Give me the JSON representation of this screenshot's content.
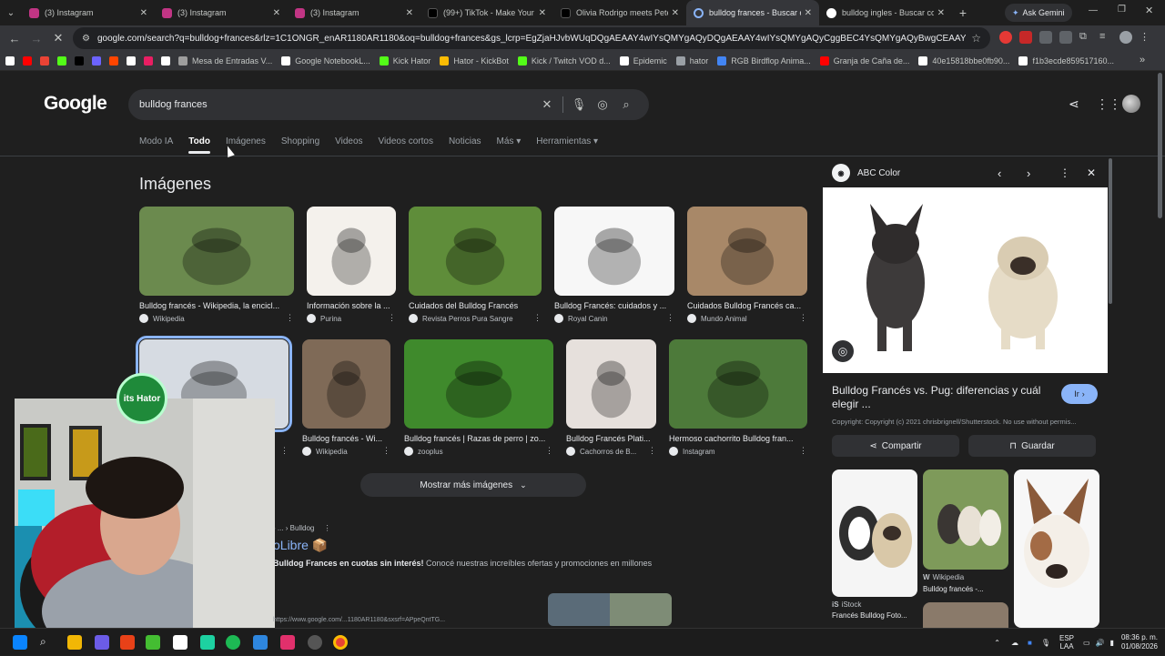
{
  "tabs": [
    {
      "label": "(3) Instagram",
      "color": "#c13584"
    },
    {
      "label": "(3) Instagram",
      "color": "#c13584"
    },
    {
      "label": "(3) Instagram",
      "color": "#c13584"
    },
    {
      "label": "(99+) TikTok - Make Your Da",
      "color": "#000000"
    },
    {
      "label": "Olivia Rodrigo meets Peter",
      "color": "#000000"
    },
    {
      "label": "bulldog frances - Buscar co",
      "color": "#4285f4",
      "active": true
    },
    {
      "label": "bulldog ingles - Buscar con",
      "color": "#4285f4"
    }
  ],
  "window": {
    "ask_gemini": "Ask Gemini"
  },
  "address": {
    "url": "google.com/search?q=bulldog+frances&rlz=1C1ONGR_enAR1180AR1180&oq=bulldog+frances&gs_lcrp=EgZjaHJvbWUqDQgAEAAY4wIYsQMYgAQyDQgAEAAY4wIYsQMYgAQyCggBEC4YsQMYgAQyBwgCEAAYgAQyCggDEAAYsQMYgAQyBwgEEAAYgAQyBwgFEAAYgAQ..."
  },
  "bookmarks": [
    {
      "label": "",
      "color": "#ffffff"
    },
    {
      "label": "",
      "color": "#ff0000"
    },
    {
      "label": "",
      "color": "#ea4335"
    },
    {
      "label": "",
      "color": "#53fc18"
    },
    {
      "label": "",
      "color": "#000000"
    },
    {
      "label": "",
      "color": "#6c63ff"
    },
    {
      "label": "",
      "color": "#ff4500"
    },
    {
      "label": "",
      "color": "#ffffff"
    },
    {
      "label": "",
      "color": "#e91e63"
    },
    {
      "label": "",
      "color": "#ffffff"
    },
    {
      "label": "Mesa de Entradas V...",
      "color": "#9e9e9e"
    },
    {
      "label": "Google NotebookL...",
      "color": "#ffffff"
    },
    {
      "label": "Kick Hator",
      "color": "#53fc18"
    },
    {
      "label": "Hator - KickBot",
      "color": "#fbbc04"
    },
    {
      "label": "Kick / Twitch VOD d...",
      "color": "#53fc18"
    },
    {
      "label": "Epidemic",
      "color": "#ffffff"
    },
    {
      "label": "hator",
      "color": "#9aa0a6"
    },
    {
      "label": "RGB Birdflop Anima...",
      "color": "#4285f4"
    },
    {
      "label": "Granja de Caña de...",
      "color": "#ff0000"
    },
    {
      "label": "40e15818bbe0fb90...",
      "color": "#ffffff"
    },
    {
      "label": "f1b3ecde859517160...",
      "color": "#ffffff"
    }
  ],
  "google": {
    "logo": "Google",
    "query": "bulldog frances",
    "tabs": [
      "Modo IA",
      "Todo",
      "Imágenes",
      "Shopping",
      "Videos",
      "Videos cortos",
      "Noticias",
      "Más ▾",
      "Herramientas ▾"
    ],
    "images_heading": "Imágenes",
    "show_more": "Mostrar más imágenes",
    "row1": [
      {
        "title": "Bulldog francés - Wikipedia, la encicl...",
        "source": "Wikipedia",
        "bg": "#6b8a4e"
      },
      {
        "title": "Información sobre la ...",
        "source": "Purina",
        "bg": "#f4f1ec"
      },
      {
        "title": "Cuidados del Bulldog Francés",
        "source": "Revista Perros Pura Sangre",
        "bg": "#5f8d3a"
      },
      {
        "title": "Bulldog Francés: cuidados y ...",
        "source": "Royal Canin",
        "bg": "#f7f7f7"
      },
      {
        "title": "Cuidados Bulldog Francés ca...",
        "source": "Mundo Animal",
        "bg": "#a88868"
      }
    ],
    "row2": [
      {
        "title": "Bulldog Francés vs. Pug: difere...",
        "source": "ABC Color",
        "bg": "#d6dbe2"
      },
      {
        "title": "Bulldog francés - Wi...",
        "source": "Wikipedia",
        "bg": "#7f6a57"
      },
      {
        "title": "Bulldog francés | Razas de perro | zo...",
        "source": "zooplus",
        "bg": "#3f8a2c"
      },
      {
        "title": "Bulldog Francés Plati...",
        "source": "Cachorros de B...",
        "bg": "#e6e0dc"
      },
      {
        "title": "Hermoso cachorrito Bulldog fran...",
        "source": "Instagram",
        "bg": "#4d7a3a"
      }
    ],
    "result": {
      "crumb": "› ... › Bulldog",
      "title": "oLibre 📦",
      "snippet_bold": "Bulldog Frances en cuotas sin interés!",
      "snippet": " Conocé nuestras increíbles ofertas y promociones en millones"
    }
  },
  "sidepanel": {
    "source": "ABC Color",
    "title": "Bulldog Francés vs. Pug: diferencias y cuál elegir ...",
    "go": "Ir",
    "copyright": "Copyright: Copyright (c) 2021 chrisbrignell/Shutterstock. No use without permis...",
    "share": "Compartir",
    "save": "Guardar",
    "related": [
      {
        "source": "iStock",
        "title": "Francés Bulldog Foto..."
      },
      {
        "source": "Wikipedia",
        "title": "Bulldog francés -..."
      }
    ]
  },
  "overlay": {
    "badge": "its Hator"
  },
  "status_url": "https://www.google.com/...1180AR1180&sxsrf=APpeQntTG...",
  "taskbar": {
    "lang": "ESP",
    "lang2": "LAA",
    "time": "08:36 p. m.",
    "date": "01/08/2026"
  }
}
